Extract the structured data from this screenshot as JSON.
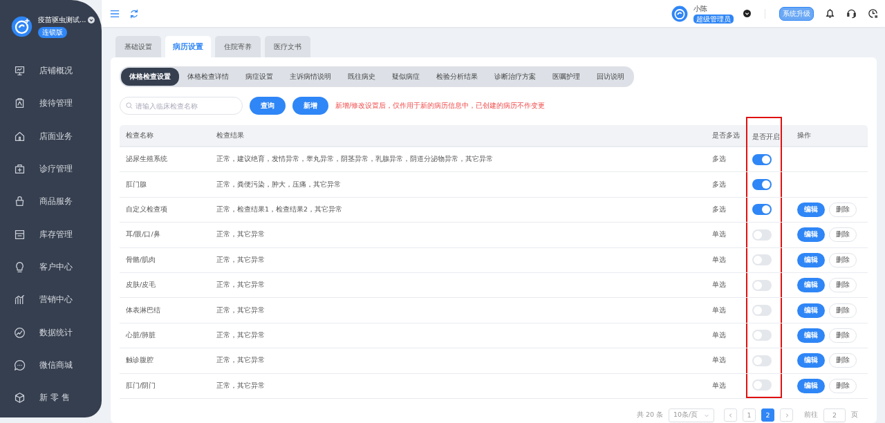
{
  "sidebar": {
    "store_name": "疫苗驱虫测试...",
    "edition": "连锁版",
    "items": [
      {
        "label": "店铺概况"
      },
      {
        "label": "接待管理"
      },
      {
        "label": "店面业务"
      },
      {
        "label": "诊疗管理"
      },
      {
        "label": "商品服务"
      },
      {
        "label": "库存管理"
      },
      {
        "label": "客户中心"
      },
      {
        "label": "营销中心"
      },
      {
        "label": "数据统计"
      },
      {
        "label": "微信商城"
      },
      {
        "label": "新 零 售"
      }
    ]
  },
  "header": {
    "user_name": "小陈",
    "user_role": "超级管理员",
    "upgrade_button": "系统升级"
  },
  "tabs": [
    {
      "label": "基础设置",
      "selected": false
    },
    {
      "label": "病历设置",
      "selected": true
    },
    {
      "label": "住院寄养",
      "selected": false
    },
    {
      "label": "医疗文书",
      "selected": false
    }
  ],
  "subtabs": [
    {
      "label": "体格检查设置",
      "selected": true
    },
    {
      "label": "体格检查详情",
      "selected": false
    },
    {
      "label": "病症设置",
      "selected": false
    },
    {
      "label": "主诉病情说明",
      "selected": false
    },
    {
      "label": "既往病史",
      "selected": false
    },
    {
      "label": "疑似病症",
      "selected": false
    },
    {
      "label": "检验分析结果",
      "selected": false
    },
    {
      "label": "诊断治疗方案",
      "selected": false
    },
    {
      "label": "医嘱护理",
      "selected": false
    },
    {
      "label": "回访说明",
      "selected": false
    }
  ],
  "search": {
    "placeholder": "请输入临床检查名称"
  },
  "buttons": {
    "query": "查询",
    "add": "新增"
  },
  "notice": "新增/修改设置后，仅作用于新的病历信息中，已创建的病历不作变更",
  "table": {
    "columns": [
      {
        "label": "检查名称",
        "highlighted": false
      },
      {
        "label": "检查结果",
        "highlighted": false
      },
      {
        "label": "是否多选",
        "highlighted": false
      },
      {
        "label": "是否开启",
        "highlighted": true
      },
      {
        "label": "操作",
        "highlighted": false
      }
    ],
    "rows": [
      {
        "name": "泌尿生殖系统",
        "results": "正常，建议绝育，发情异常，睾丸异常，阴茎异常，乳腺异常，阴道分泌物异常，其它异常",
        "multi": "多选",
        "on": true
      },
      {
        "name": "肛门腺",
        "results": "正常，粪便污染，肿大，压痛，其它异常",
        "multi": "多选",
        "on": true
      },
      {
        "name": "自定义检查项",
        "results": "正常，检查结果1，检查结果2，其它异常",
        "multi": "多选",
        "on": true,
        "actions": [
          "编辑",
          "删除"
        ]
      },
      {
        "name": "耳/眼/口/鼻",
        "results": "正常，其它异常",
        "multi": "单选",
        "on": false,
        "actions": [
          "编辑",
          "删除"
        ]
      },
      {
        "name": "骨骼/肌肉",
        "results": "正常，其它异常",
        "multi": "单选",
        "on": false,
        "actions": [
          "编辑",
          "删除"
        ]
      },
      {
        "name": "皮肤/皮毛",
        "results": "正常，其它异常",
        "multi": "单选",
        "on": false,
        "actions": [
          "编辑",
          "删除"
        ]
      },
      {
        "name": "体表淋巴结",
        "results": "正常，其它异常",
        "multi": "单选",
        "on": false,
        "actions": [
          "编辑",
          "删除"
        ]
      },
      {
        "name": "心脏/肺脏",
        "results": "正常，其它异常",
        "multi": "单选",
        "on": false,
        "actions": [
          "编辑",
          "删除"
        ]
      },
      {
        "name": "触诊腹腔",
        "results": "正常，其它异常",
        "multi": "单选",
        "on": false,
        "actions": [
          "编辑",
          "删除"
        ]
      },
      {
        "name": "肛门/阴门",
        "results": "正常，其它异常",
        "multi": "单选",
        "on": false,
        "actions": [
          "编辑",
          "删除"
        ]
      }
    ]
  },
  "pagination": {
    "total": "共 20 条",
    "page_size": "10条/页",
    "pages": [
      {
        "label": "1",
        "selected": false
      },
      {
        "label": "2",
        "selected": true
      }
    ],
    "goto_label": "前往",
    "goto_value": "2",
    "goto_suffix": "页"
  }
}
